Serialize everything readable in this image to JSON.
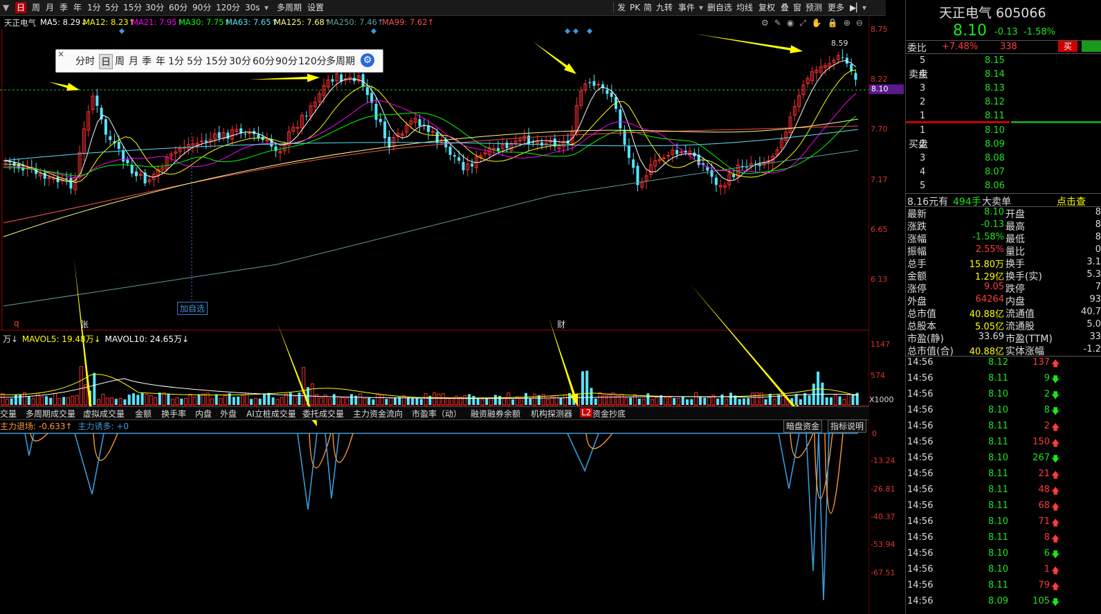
{
  "toolbar": {
    "periods": [
      "日",
      "周",
      "月",
      "季",
      "年",
      "1分",
      "5分",
      "15分",
      "30分",
      "60分",
      "90分",
      "120分",
      "30s"
    ],
    "extra": [
      "多周期",
      "设置"
    ],
    "right_items": [
      "发",
      "PK",
      "简",
      "九转",
      "事件",
      "删自选",
      "均线",
      "复权",
      "叠",
      "窗",
      "预测",
      "更多"
    ]
  },
  "ma": {
    "stock": "天正电气",
    "items": [
      {
        "text": "MA5: 8.29↓",
        "color": "#ffffff"
      },
      {
        "text": "MA12: 8.23↑",
        "color": "#ffff00"
      },
      {
        "text": "MA21: 7.95↑",
        "color": "#ff00ff"
      },
      {
        "text": "MA30: 7.75↑",
        "color": "#00ff00"
      },
      {
        "text": "MA63: 7.65↑",
        "color": "#55e5ff"
      },
      {
        "text": "MA125: 7.68↑",
        "color": "#ffff80"
      },
      {
        "text": "MA250: 7.46↑",
        "color": "#5f9ea0"
      },
      {
        "text": "MA99: 7.62↑",
        "color": "#ff5050"
      }
    ]
  },
  "price_axis": [
    "8.75",
    "8.22",
    "8.10",
    "7.70",
    "7.17",
    "6.65",
    "6.13"
  ],
  "popup": [
    "分时",
    "日",
    "周",
    "月",
    "季",
    "年",
    "1分",
    "5分",
    "15分",
    "30分",
    "60分",
    "90分",
    "120分",
    "多周期"
  ],
  "chart_labels": {
    "high": "8.59",
    "add_watch": "加自选",
    "mark_q": "q",
    "mark_zhang": "张",
    "mark_cai": "财"
  },
  "vol": {
    "legend": [
      "万↓",
      "MAVOL5: 19.48万↓",
      "MAVOL10: 24.65万↓"
    ],
    "axis": [
      "1147",
      "574",
      "X1000"
    ]
  },
  "tabs": [
    "交量",
    "多周期成交量",
    "虚拟成交量",
    "金额",
    "换手率",
    "内盘",
    "外盘",
    "AI立桩成交量",
    "委托成交量",
    "主力资金流向",
    "市盈率（动）",
    "融资融券余额",
    "机构探测器",
    "资金抄底"
  ],
  "tab_badge": "L2",
  "ind": {
    "legend": [
      "主力退场: -0.633↑",
      "主力诱多: +0"
    ],
    "buttons": [
      "暗盘资金",
      "指标说明"
    ],
    "axis": [
      "0",
      "-13.24",
      "-26.81",
      "-40.37",
      "-53.94",
      "-67.51"
    ]
  },
  "quote": {
    "name": "天正电气 605066",
    "price": "8.10",
    "change": "-0.13",
    "pct": "-1.58%",
    "weibi_label": "委比",
    "weibi": "+7.48%",
    "weibi_vol": "338",
    "buy_btn": "买",
    "sell_label": "卖盘",
    "buy_label": "买盘",
    "asks": [
      {
        "lvl": "5",
        "price": "8.15"
      },
      {
        "lvl": "4",
        "price": "8.14"
      },
      {
        "lvl": "3",
        "price": "8.13"
      },
      {
        "lvl": "2",
        "price": "8.12"
      },
      {
        "lvl": "1",
        "price": "8.11"
      }
    ],
    "bids": [
      {
        "lvl": "1",
        "price": "8.10"
      },
      {
        "lvl": "2",
        "price": "8.09"
      },
      {
        "lvl": "3",
        "price": "8.08"
      },
      {
        "lvl": "4",
        "price": "8.07"
      },
      {
        "lvl": "5",
        "price": "8.06"
      }
    ],
    "bigorder": {
      "a": "8.16元有",
      "b": "494手",
      "c": "大卖单",
      "d": "点击查"
    },
    "stats": [
      {
        "l": "最新",
        "v": "8.10",
        "c": "green",
        "l2": "开盘",
        "v2": "8"
      },
      {
        "l": "涨跌",
        "v": "-0.13",
        "c": "green",
        "l2": "最高",
        "v2": "8"
      },
      {
        "l": "涨幅",
        "v": "-1.58%",
        "c": "green",
        "l2": "最低",
        "v2": "8"
      },
      {
        "l": "振幅",
        "v": "2.55%",
        "c": "red",
        "l2": "量比",
        "v2": "0"
      },
      {
        "l": "总手",
        "v": "15.80万",
        "c": "yellow",
        "l2": "换手",
        "v2": "3.1"
      },
      {
        "l": "金额",
        "v": "1.29亿",
        "c": "yellow",
        "l2": "换手(实)",
        "v2": "5.3"
      },
      {
        "l": "涨停",
        "v": "9.05",
        "c": "red",
        "l2": "跌停",
        "v2": "7"
      },
      {
        "l": "外盘",
        "v": "64264",
        "c": "red",
        "l2": "内盘",
        "v2": "93"
      },
      {
        "l": "总市值",
        "v": "40.88亿",
        "c": "yellow",
        "l2": "流通值",
        "v2": "40.7"
      },
      {
        "l": "总股本",
        "v": "5.05亿",
        "c": "yellow",
        "l2": "流通股",
        "v2": "5.0"
      },
      {
        "l": "市盈(静)",
        "v": "33.69",
        "c": "white",
        "l2": "市盈(TTM)",
        "v2": "33"
      },
      {
        "l": "总市值(合)",
        "v": "40.88亿",
        "c": "yellow",
        "l2": "实体涨幅",
        "v2": "-1.2"
      }
    ],
    "ticks": [
      {
        "t": "14:56",
        "p": "8.12",
        "v": "137",
        "d": "up"
      },
      {
        "t": "14:56",
        "p": "8.11",
        "v": "9",
        "d": "down"
      },
      {
        "t": "14:56",
        "p": "8.10",
        "v": "2",
        "d": "down"
      },
      {
        "t": "14:56",
        "p": "8.10",
        "v": "8",
        "d": "down"
      },
      {
        "t": "14:56",
        "p": "8.11",
        "v": "2",
        "d": "up"
      },
      {
        "t": "14:56",
        "p": "8.11",
        "v": "150",
        "d": "up"
      },
      {
        "t": "14:56",
        "p": "8.10",
        "v": "267",
        "d": "down"
      },
      {
        "t": "14:56",
        "p": "8.11",
        "v": "21",
        "d": "up"
      },
      {
        "t": "14:56",
        "p": "8.11",
        "v": "48",
        "d": "up"
      },
      {
        "t": "14:56",
        "p": "8.11",
        "v": "68",
        "d": "up"
      },
      {
        "t": "14:56",
        "p": "8.10",
        "v": "71",
        "d": "up"
      },
      {
        "t": "14:56",
        "p": "8.11",
        "v": "8",
        "d": "up"
      },
      {
        "t": "14:56",
        "p": "8.10",
        "v": "6",
        "d": "down"
      },
      {
        "t": "14:56",
        "p": "8.10",
        "v": "1",
        "d": "up"
      },
      {
        "t": "14:56",
        "p": "8.11",
        "v": "79",
        "d": "up"
      },
      {
        "t": "14:56",
        "p": "8.09",
        "v": "105",
        "d": "down"
      }
    ]
  }
}
